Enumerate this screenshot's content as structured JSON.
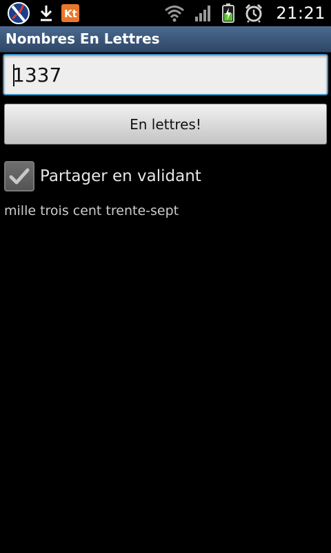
{
  "status_bar": {
    "time": "21:21",
    "icons": [
      "app-logo-icon",
      "download-icon",
      "kt-app-icon",
      "wifi-icon",
      "signal-icon",
      "battery-charging-icon",
      "alarm-clock-icon"
    ],
    "kt_label": "Kt"
  },
  "app": {
    "title": "Nombres En Lettres"
  },
  "form": {
    "number_value": "1337",
    "convert_button_label": "En lettres!",
    "share_checkbox_label": "Partager en validant",
    "share_checked": true
  },
  "result": {
    "text": "mille trois cent trente-sept"
  },
  "colors": {
    "title_bar": "#3a5678",
    "input_focus_border": "#3d8fc2",
    "background": "#000000"
  }
}
